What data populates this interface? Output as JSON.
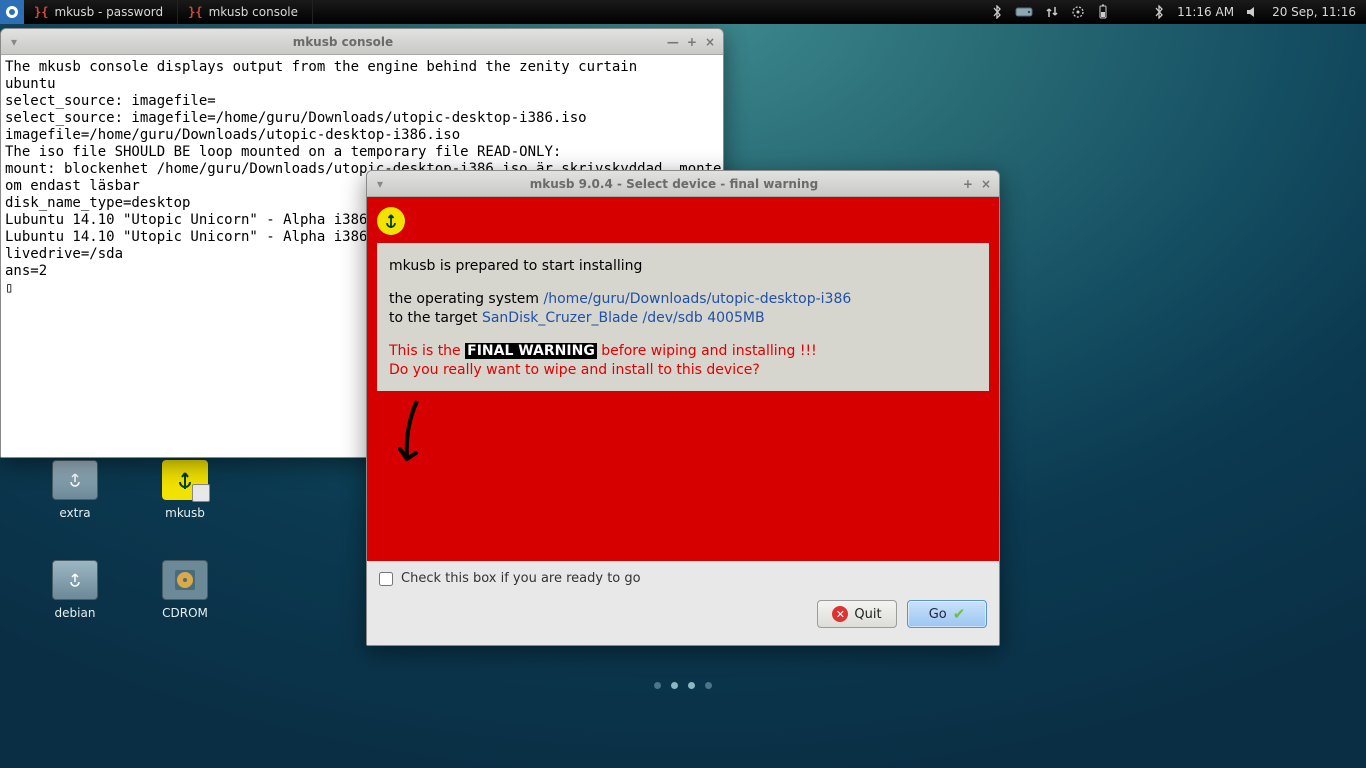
{
  "panel": {
    "task1": "mkusb - password",
    "task2": "mkusb console",
    "time1": "11:16 AM",
    "date": "20 Sep, 11:16"
  },
  "desktop": {
    "icon1": "extra",
    "icon2": "mkusb",
    "icon3": "debian",
    "icon4": "CDROM"
  },
  "console": {
    "title": "mkusb console",
    "body": "The mkusb console displays output from the engine behind the zenity curtain\nubuntu\nselect_source: imagefile=\nselect_source: imagefile=/home/guru/Downloads/utopic-desktop-i386.iso\nimagefile=/home/guru/Downloads/utopic-desktop-i386.iso\nThe iso file SHOULD BE loop mounted on a temporary file READ-ONLY:\nmount: blockenhet /home/guru/Downloads/utopic-desktop-i386.iso är skrivskyddad, monterar s\nom endast läsbar\ndisk_name_type=desktop\nLubuntu 14.10 \"Utopic Unicorn\" - Alpha i386 _\nLubuntu 14.10 \"Utopic Unicorn\" - Alpha i386 _\nlivedrive=/sda\nans=2\n▯"
  },
  "dialog": {
    "title": "mkusb 9.0.4 - Select device - final warning",
    "line1": "mkusb is prepared to start installing",
    "line2_pre": "the operating system ",
    "line2_link": "/home/guru/Downloads/utopic-desktop-i386",
    "line3_pre": "to the target ",
    "line3_link": "SanDisk_Cruzer_Blade /dev/sdb 4005MB",
    "warn_pre": "This is the ",
    "warn_fw": "FINAL WARNING",
    "warn_post": " before wiping and installing !!!",
    "confirm": "Do you really want to wipe and install to this device?",
    "checkbox_label": "Check this box if you are ready to go",
    "quit": "Quit",
    "go": "Go"
  }
}
